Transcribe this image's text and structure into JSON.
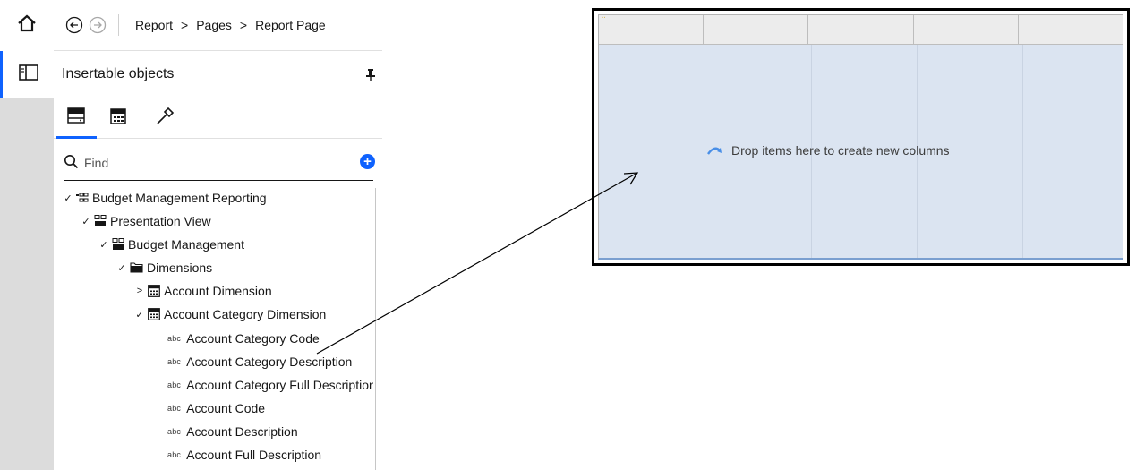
{
  "header": {
    "breadcrumb": [
      "Report",
      "Pages",
      "Report Page"
    ],
    "crumb_separator": ">"
  },
  "panel": {
    "title": "Insertable objects"
  },
  "tabs": [
    {
      "icon": "source-icon",
      "active": true
    },
    {
      "icon": "data-items-icon",
      "active": false
    },
    {
      "icon": "toolbox-icon",
      "active": false
    }
  ],
  "search": {
    "placeholder": "Find",
    "add_label": "+"
  },
  "tree": {
    "n0": {
      "label": "Budget Management Reporting",
      "expanded": true
    },
    "n1": {
      "label": "Presentation View",
      "expanded": true
    },
    "n2": {
      "label": "Budget Management",
      "expanded": true
    },
    "n3": {
      "label": "Dimensions",
      "expanded": true
    },
    "n4": {
      "label": "Account Dimension",
      "expanded": false
    },
    "n5": {
      "label": "Account Category Dimension",
      "expanded": true
    },
    "n6": {
      "label": "Account Category Code",
      "type": "abc"
    },
    "n7": {
      "label": "Account Category Description",
      "type": "abc"
    },
    "n8": {
      "label": "Account Category Full Description",
      "type": "abc"
    },
    "n9": {
      "label": "Account Code",
      "type": "abc"
    },
    "n10": {
      "label": "Account Description",
      "type": "abc"
    },
    "n11": {
      "label": "Account Full Description",
      "type": "abc"
    }
  },
  "abc_tag": "abc",
  "canvas": {
    "drop_text": "Drop items here to create new columns",
    "handle": "⁚⁚"
  },
  "colors": {
    "accent": "#0f62fe",
    "drop_zone": "#dbe4f1",
    "header_cells": "#ececec"
  }
}
